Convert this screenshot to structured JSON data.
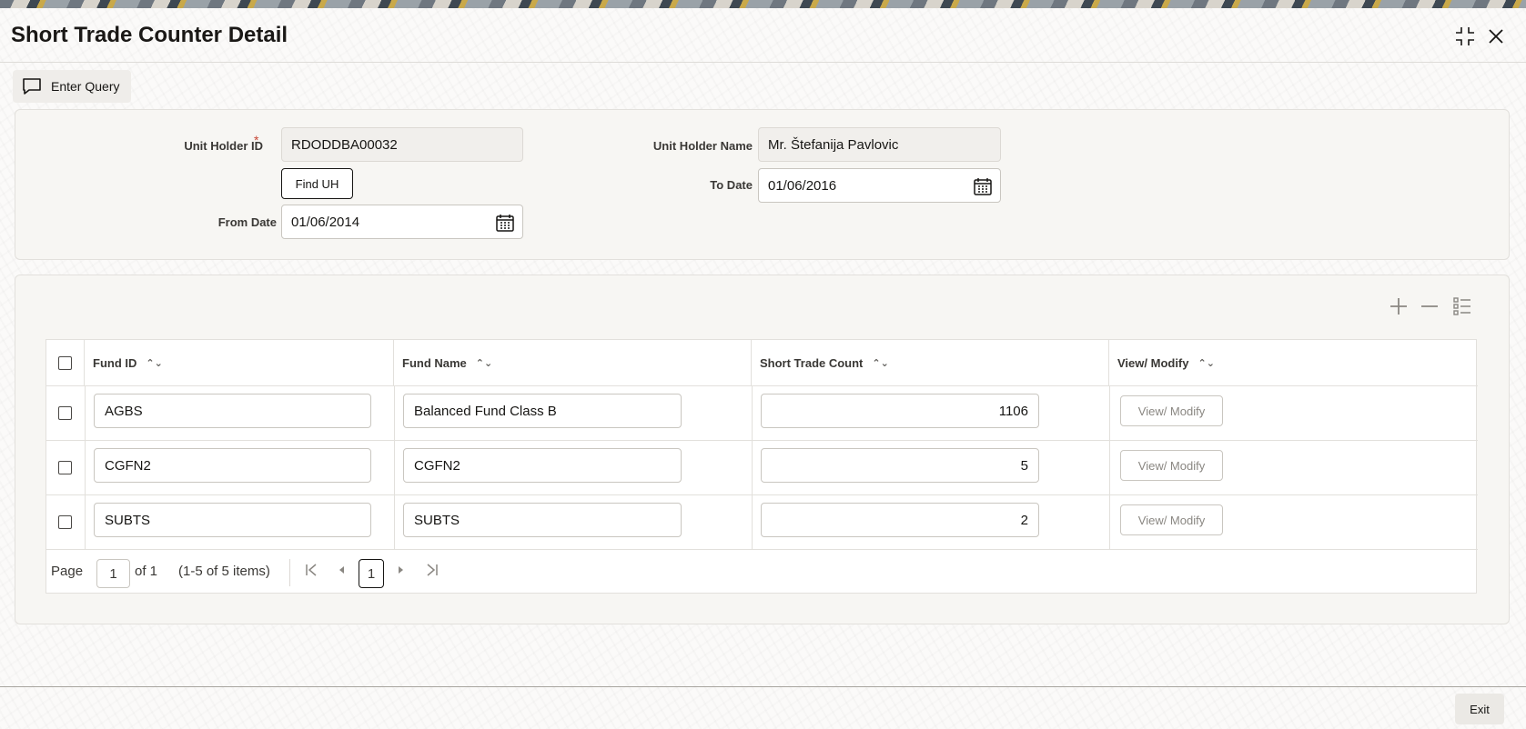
{
  "window": {
    "title": "Short Trade Counter Detail",
    "maximize_icon": "maximize-icon",
    "close_icon": "close-icon"
  },
  "toolbar": {
    "enter_query_label": "Enter Query",
    "enter_query_icon": "chat-bubble-icon"
  },
  "form": {
    "unit_holder_id_label": "Unit Holder ID",
    "required_marker": "*",
    "unit_holder_id_value": "RDODDBA00032",
    "find_uh_label": "Find UH",
    "from_date_label": "From Date",
    "from_date_value": "01/06/2014",
    "unit_holder_name_label": "Unit Holder Name",
    "unit_holder_name_value": "Mr. Štefanija Pavlovic",
    "to_date_label": "To Date",
    "to_date_value": "01/06/2016"
  },
  "grid": {
    "columns": [
      "Fund ID",
      "Fund Name",
      "Short Trade Count",
      "View/ Modify"
    ],
    "rows": [
      {
        "fund_id": "AGBS",
        "fund_name": "Balanced Fund Class B",
        "short_trade_count": "1106",
        "action": "View/ Modify"
      },
      {
        "fund_id": "CGFN2",
        "fund_name": "CGFN2",
        "short_trade_count": "5",
        "action": "View/ Modify"
      },
      {
        "fund_id": "SUBTS",
        "fund_name": "SUBTS",
        "short_trade_count": "2",
        "action": "View/ Modify"
      }
    ],
    "actions": [
      "add-row-icon",
      "remove-row-icon",
      "list-settings-icon"
    ]
  },
  "pagination": {
    "page_label": "Page",
    "page_value": "1",
    "of_label": "of 1",
    "items_label": "(1-5 of 5 items)",
    "current_page": "1"
  },
  "footer": {
    "exit_label": "Exit"
  }
}
